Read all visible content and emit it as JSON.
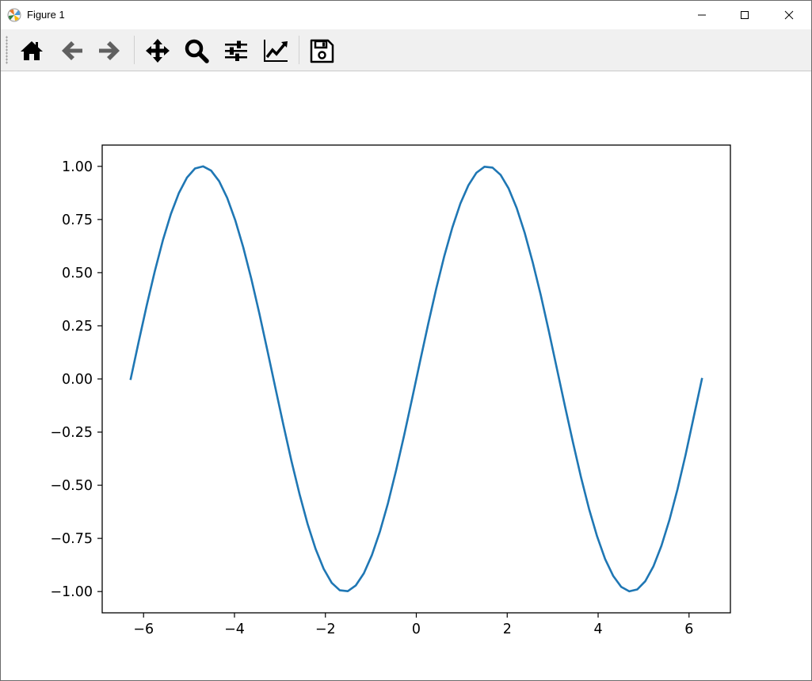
{
  "window": {
    "title": "Figure 1",
    "icons": {
      "app": "matplotlib-logo-icon",
      "minimize": "minimize-icon",
      "maximize": "maximize-icon",
      "close": "close-icon"
    }
  },
  "toolbar": {
    "buttons": [
      {
        "name": "home",
        "icon": "home-icon"
      },
      {
        "name": "back",
        "icon": "arrow-left-icon"
      },
      {
        "name": "forward",
        "icon": "arrow-right-icon"
      },
      {
        "name": "pan",
        "icon": "move-icon"
      },
      {
        "name": "zoom",
        "icon": "magnifier-icon"
      },
      {
        "name": "subplots",
        "icon": "sliders-icon"
      },
      {
        "name": "customize",
        "icon": "line-chart-icon"
      },
      {
        "name": "save",
        "icon": "floppy-disk-icon"
      }
    ]
  },
  "chart_data": {
    "type": "line",
    "title": "",
    "xlabel": "",
    "ylabel": "",
    "xlim": [
      -6.91,
      6.91
    ],
    "ylim": [
      -1.1,
      1.1
    ],
    "xticks": [
      -6,
      -4,
      -2,
      0,
      2,
      4,
      6
    ],
    "xtick_labels": [
      "−6",
      "−4",
      "−2",
      "0",
      "2",
      "4",
      "6"
    ],
    "yticks": [
      1.0,
      0.75,
      0.5,
      0.25,
      0.0,
      -0.25,
      -0.5,
      -0.75,
      -1.0
    ],
    "ytick_labels": [
      "1.00",
      "0.75",
      "0.50",
      "0.25",
      "0.00",
      "−0.25",
      "−0.50",
      "−0.75",
      "−1.00"
    ],
    "grid": false,
    "legend": "none",
    "series": [
      {
        "color": "#1f77b4",
        "x": [
          -6.2832,
          -6.1063,
          -5.9294,
          -5.7525,
          -5.5756,
          -5.3987,
          -5.2218,
          -5.0449,
          -4.868,
          -4.6911,
          -4.5142,
          -4.3373,
          -4.1604,
          -3.9835,
          -3.8066,
          -3.6297,
          -3.4528,
          -3.2759,
          -3.099,
          -2.9221,
          -2.7452,
          -2.5683,
          -2.3914,
          -2.2145,
          -2.0376,
          -1.8607,
          -1.6838,
          -1.5069,
          -1.33,
          -1.1531,
          -0.9762,
          -0.7993,
          -0.6224,
          -0.4455,
          -0.2686,
          -0.0917,
          0.0852,
          0.2621,
          0.439,
          0.6159,
          0.7928,
          0.9697,
          1.1466,
          1.3235,
          1.5004,
          1.6773,
          1.8542,
          2.0311,
          2.208,
          2.3849,
          2.5618,
          2.7387,
          2.9156,
          3.0925,
          3.2694,
          3.4463,
          3.6232,
          3.8001,
          3.977,
          4.1539,
          4.3308,
          4.5077,
          4.6846,
          4.8615,
          5.0384,
          5.2153,
          5.3922,
          5.5691,
          5.746,
          5.9229,
          6.0998,
          6.2832
        ],
        "y": [
          0.0,
          0.176,
          0.347,
          0.507,
          0.652,
          0.776,
          0.875,
          0.947,
          0.99,
          1.0,
          0.98,
          0.93,
          0.852,
          0.747,
          0.619,
          0.471,
          0.308,
          0.134,
          -0.043,
          -0.218,
          -0.387,
          -0.542,
          -0.682,
          -0.8,
          -0.893,
          -0.959,
          -0.994,
          -0.998,
          -0.971,
          -0.914,
          -0.828,
          -0.717,
          -0.584,
          -0.431,
          -0.266,
          -0.092,
          0.085,
          0.259,
          0.425,
          0.578,
          0.712,
          0.825,
          0.911,
          0.97,
          0.998,
          0.994,
          0.96,
          0.896,
          0.804,
          0.687,
          0.548,
          0.394,
          0.225,
          0.049,
          -0.127,
          -0.298,
          -0.462,
          -0.611,
          -0.74,
          -0.847,
          -0.926,
          -0.978,
          -0.999,
          -0.99,
          -0.951,
          -0.882,
          -0.785,
          -0.663,
          -0.519,
          -0.358,
          -0.182,
          0.0
        ]
      }
    ]
  }
}
